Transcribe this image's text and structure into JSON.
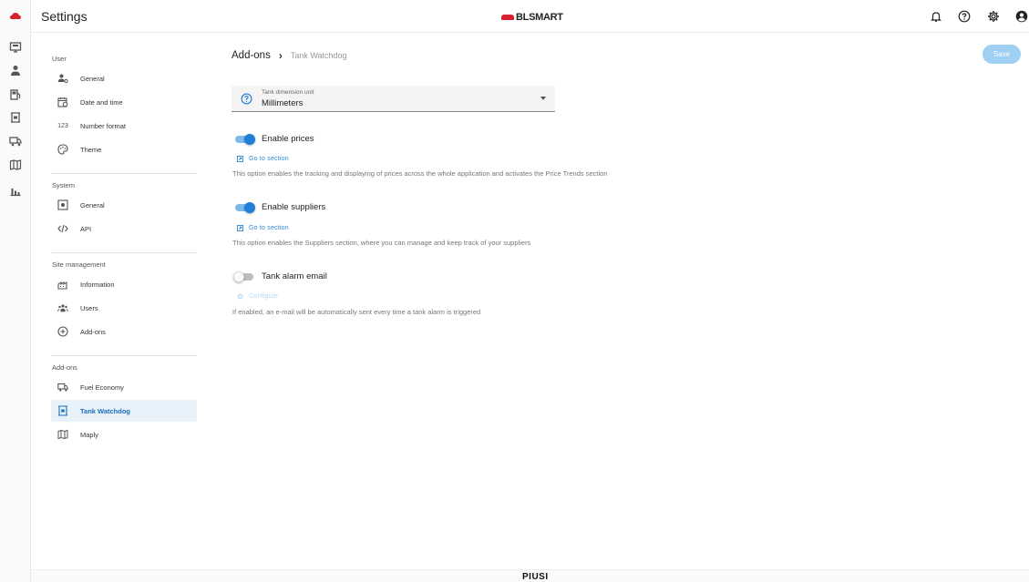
{
  "app": {
    "title": "Settings",
    "brand": "BLSMART",
    "footer_logo": "PIUSI"
  },
  "colors": {
    "accent": "#1e7fd6",
    "active_bg": "#e7f2fb",
    "save_bg": "#9fd0f3",
    "brand_red": "#d8202f"
  },
  "rail_icons": [
    "cloud-logo-icon",
    "monitor-icon",
    "person-icon",
    "fuel-pump-icon",
    "tank-icon",
    "truck-icon",
    "map-icon",
    "chart-icon"
  ],
  "header_icons": [
    "bell-icon",
    "help-icon",
    "gear-icon",
    "account-icon"
  ],
  "nav": {
    "user": {
      "title": "User",
      "items": [
        "General",
        "Date and time",
        "Number format",
        "Theme"
      ],
      "number_format_icon_text": "123"
    },
    "system": {
      "title": "System",
      "items": [
        "General",
        "API"
      ]
    },
    "site": {
      "title": "Site management",
      "items": [
        "Information",
        "Users",
        "Add-ons"
      ]
    },
    "addons": {
      "title": "Add-ons",
      "items": [
        "Fuel Economy",
        "Tank Watchdog",
        "Maply"
      ]
    }
  },
  "breadcrumb": {
    "parent": "Add-ons",
    "current": "Tank Watchdog"
  },
  "save_label": "Save",
  "dimension": {
    "label": "Tank dimension unit",
    "value": "Millimeters"
  },
  "options": [
    {
      "label": "Enable prices",
      "enabled": true,
      "link": "Go to section",
      "description": "This option enables the tracking and displaying of prices across the whole application and activates the Price Trends section"
    },
    {
      "label": "Enable suppliers",
      "enabled": true,
      "link": "Go to section",
      "description": "This option enables the Suppliers section, where you can manage and keep track of your suppliers"
    },
    {
      "label": "Tank alarm email",
      "enabled": false,
      "link": "Configure",
      "description": "If enabled, an e-mail will be automatically sent every time a tank alarm is triggered"
    }
  ]
}
